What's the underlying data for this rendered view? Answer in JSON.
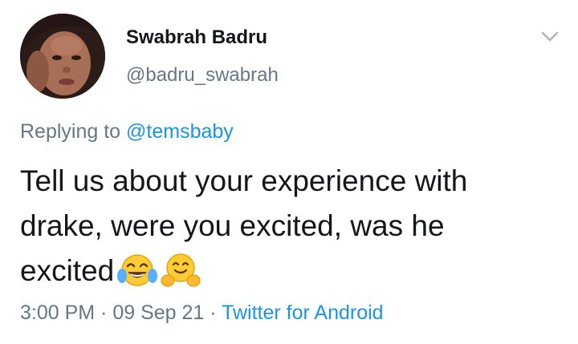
{
  "tweet": {
    "display_name": "Swabrah Badru",
    "handle": "@badru_swabrah",
    "replying_prefix": "Replying to ",
    "replying_to": "@temsbaby",
    "text_line1": "Tell us about your experience with",
    "text_line2": "drake,  were you excited,  was he",
    "text_line3": "excited",
    "emojis": [
      "face-with-tears-of-joy-emoji",
      "hugging-face-emoji"
    ],
    "time": "3:00 PM",
    "separator": " · ",
    "date": "09 Sep 21",
    "source": "Twitter for Android"
  },
  "colors": {
    "text": "#14171a",
    "secondary": "#657786",
    "link": "#1b95e0"
  }
}
